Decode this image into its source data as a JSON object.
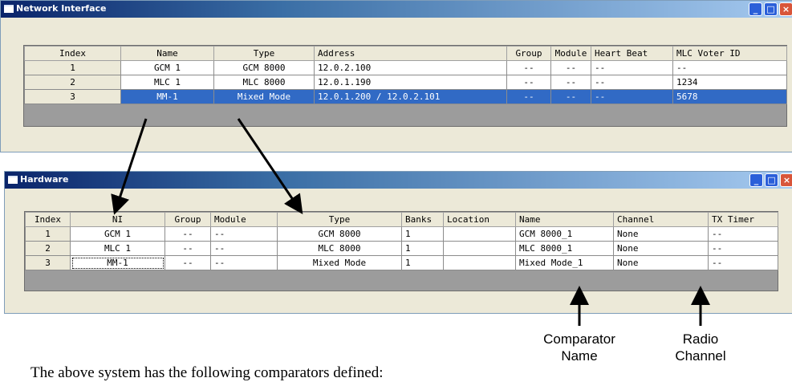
{
  "ni_window": {
    "title": "Network Interface",
    "columns": [
      "Index",
      "Name",
      "Type",
      "Address",
      "Group",
      "Module",
      "Heart Beat",
      "MLC Voter ID"
    ],
    "rows": [
      [
        "1",
        "GCM 1",
        "GCM 8000",
        "12.0.2.100",
        "--",
        "--",
        "--",
        "--"
      ],
      [
        "2",
        "MLC 1",
        "MLC 8000",
        "12.0.1.190",
        "--",
        "--",
        "--",
        "1234"
      ],
      [
        "3",
        "MM-1",
        "Mixed Mode",
        "12.0.1.200 / 12.0.2.101",
        "--",
        "--",
        "--",
        "5678"
      ]
    ],
    "selected_row": 3
  },
  "hw_window": {
    "title": "Hardware",
    "columns": [
      "Index",
      "NI",
      "Group",
      "Module",
      "Type",
      "Banks",
      "Location",
      "Name",
      "Channel",
      "TX Timer"
    ],
    "rows": [
      [
        "1",
        "GCM 1",
        "--",
        "--",
        "GCM 8000",
        "1",
        "",
        "GCM 8000_1",
        "None",
        "--"
      ],
      [
        "2",
        "MLC 1",
        "--",
        "--",
        "MLC 8000",
        "1",
        "",
        "MLC 8000_1",
        "None",
        "--"
      ],
      [
        "3",
        "MM-1",
        "--",
        "--",
        "Mixed Mode",
        "1",
        "",
        "Mixed Mode_1",
        "None",
        "--"
      ]
    ]
  },
  "captions": {
    "comparator": "Comparator\nName",
    "radio": "Radio\nChannel"
  },
  "note": "The above system has the following comparators defined:",
  "icons": {
    "window_icon": "window-icon",
    "minimize": "minimize-icon",
    "maximize": "maximize-icon",
    "close": "close-icon"
  },
  "colors": {
    "selection": "#316ac5",
    "titlebar": "#0a246a",
    "grid_bg": "#9c9c9c"
  }
}
